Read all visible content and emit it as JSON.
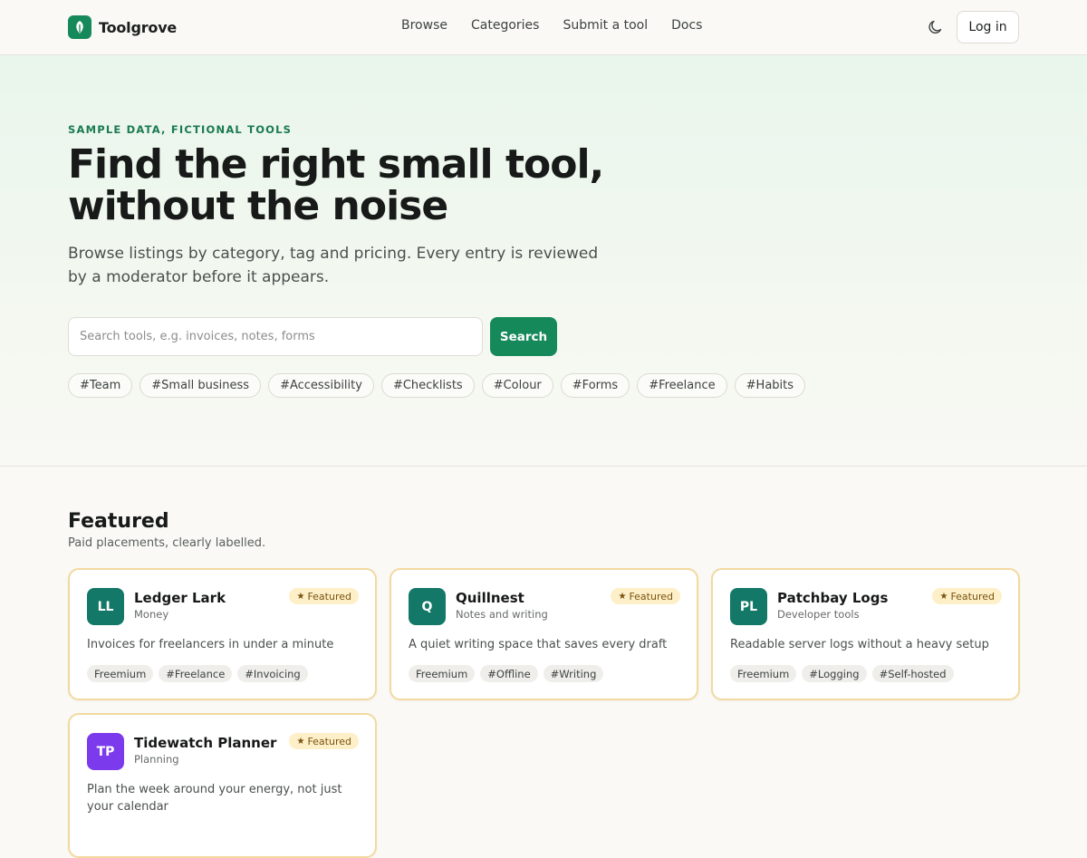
{
  "header": {
    "brand": "Toolgrove",
    "nav": [
      "Browse",
      "Categories",
      "Submit a tool",
      "Docs"
    ],
    "login_label": "Log in"
  },
  "hero": {
    "eyebrow": "SAMPLE DATA, FICTIONAL TOOLS",
    "title": "Find the right small tool, without the noise",
    "subtitle": "Browse listings by category, tag and pricing. Every entry is reviewed by a moderator before it appears.",
    "search_placeholder": "Search tools, e.g. invoices, notes, forms",
    "search_value": "",
    "search_button": "Search",
    "tags": [
      "#Team",
      "#Small business",
      "#Accessibility",
      "#Checklists",
      "#Colour",
      "#Forms",
      "#Freelance",
      "#Habits"
    ]
  },
  "featured": {
    "title": "Featured",
    "subtitle": "Paid placements, clearly labelled.",
    "badge_label": "Featured",
    "cards": [
      {
        "initials": "LL",
        "name": "Ledger Lark",
        "category": "Money",
        "color": "#137867",
        "description": "Invoices for freelancers in under a minute",
        "chips": [
          "Freemium",
          "#Freelance",
          "#Invoicing"
        ]
      },
      {
        "initials": "Q",
        "name": "Quillnest",
        "category": "Notes and writing",
        "color": "#137867",
        "description": "A quiet writing space that saves every draft",
        "chips": [
          "Freemium",
          "#Offline",
          "#Writing"
        ]
      },
      {
        "initials": "PL",
        "name": "Patchbay Logs",
        "category": "Developer tools",
        "color": "#137867",
        "description": "Readable server logs without a heavy setup",
        "chips": [
          "Freemium",
          "#Logging",
          "#Self-hosted"
        ]
      },
      {
        "initials": "TP",
        "name": "Tidewatch Planner",
        "category": "Planning",
        "color": "#7c3aed",
        "description": "Plan the week around your energy, not just your calendar",
        "chips": []
      }
    ]
  },
  "colors": {
    "accent": "#16895a",
    "featured_border": "#f3d9a0",
    "badge_bg": "#fdf0c8"
  },
  "icons": {
    "logo": "leaf-icon",
    "theme": "moon-icon",
    "badge": "star-icon"
  }
}
